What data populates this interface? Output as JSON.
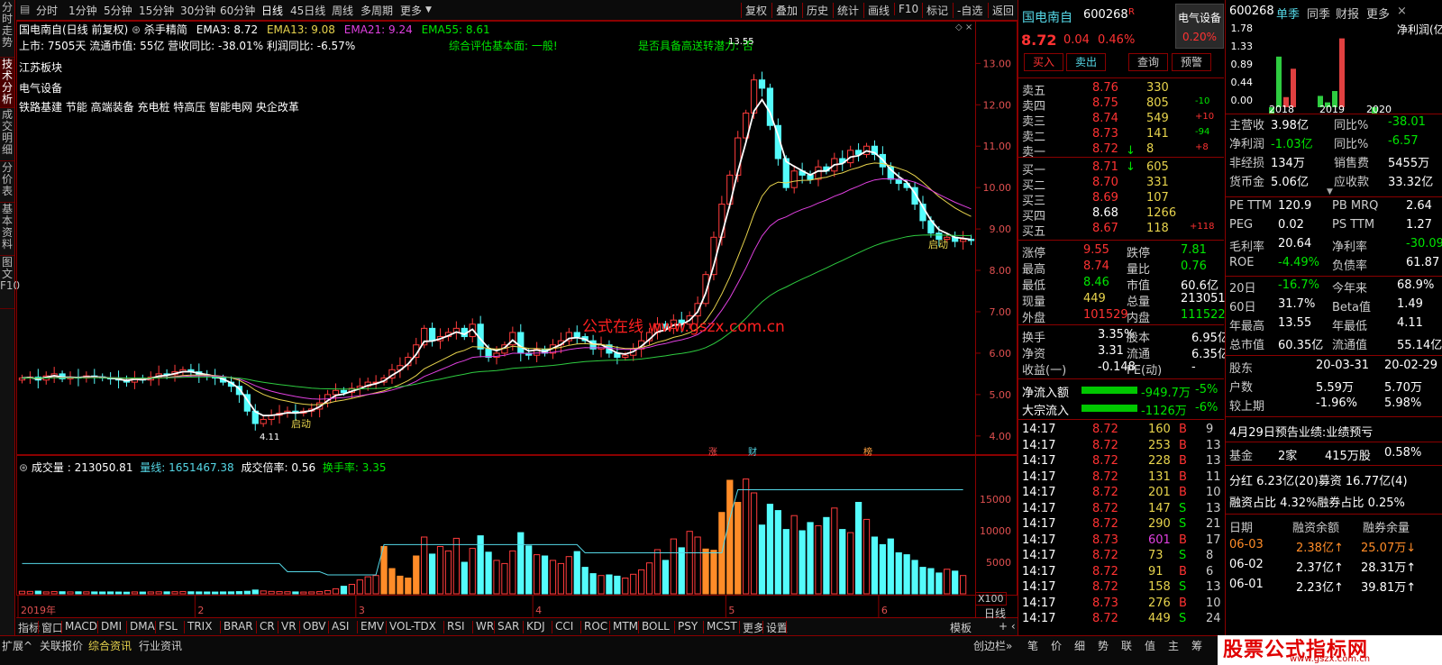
{
  "toolbar": {
    "items": [
      "分时",
      "1分钟",
      "5分钟",
      "15分钟",
      "30分钟",
      "60分钟",
      "日线",
      "45日线",
      "周线",
      "多周期",
      "更多"
    ],
    "right": [
      "复权",
      "叠加",
      "历史",
      "统计",
      "画线",
      "F10",
      "标记",
      "-自选",
      "返回"
    ]
  },
  "left_tabs": [
    "分时走势",
    "技术分析",
    "成交明细",
    "分价表",
    "基本资料",
    "图文F10"
  ],
  "chart_header": {
    "title": "国电南自(日线 前复权)",
    "formula": "杀手精简",
    "ema3": "EMA3: 8.72",
    "ema13": "EMA13: 9.08",
    "ema21": "EMA21: 9.24",
    "ema55": "EMA55: 8.61"
  },
  "info_lines": {
    "line1": "上市: 7505天  流通市值: 55亿    营收同比: -38.01% 利润同比: -6.57%",
    "eval": "综合评估基本面: 一般!",
    "gaosong": "是否具备高送转潜力: 否",
    "board": "江苏板块",
    "industry": "电气设备",
    "concepts": "铁路基建 节能 高端装备 充电桩 特高压 智能电网 央企改革"
  },
  "watermark": "公式在线 www.gszx.com.cn",
  "annotations": {
    "start1": "启动",
    "start2": "启动",
    "low": "4.11",
    "high": "13.55",
    "zhang": "涨",
    "cai": "财",
    "bang": "榜"
  },
  "price_axis": [
    "13.00",
    "12.00",
    "11.00",
    "10.00",
    "9.00",
    "8.00",
    "7.00",
    "6.00",
    "5.00",
    "4.00"
  ],
  "vol_axis": [
    "15000",
    "10000",
    "5000"
  ],
  "vol_unit": "X100",
  "vol_header": {
    "label": "成交量 : 213050.81",
    "liang": "量线: 1651467.38",
    "bei": "成交倍率: 0.56",
    "huan": "换手率: 3.35"
  },
  "x_labels": [
    "2019年",
    "2",
    "3",
    "4",
    "5",
    "6"
  ],
  "chart_data": {
    "type": "candlestick",
    "price_ylim": [
      3.8,
      13.9
    ],
    "vol_ylim": [
      0,
      20000
    ],
    "closes": [
      5.4,
      5.42,
      5.35,
      5.45,
      5.5,
      5.38,
      5.42,
      5.4,
      5.45,
      5.43,
      5.4,
      5.38,
      5.35,
      5.3,
      5.4,
      5.35,
      5.42,
      5.5,
      5.48,
      5.55,
      5.6,
      5.55,
      5.48,
      5.45,
      5.4,
      5.3,
      5.2,
      5.0,
      4.6,
      4.3,
      4.4,
      4.5,
      4.55,
      4.6,
      4.55,
      4.6,
      4.65,
      4.8,
      5.0,
      5.1,
      5.05,
      5.15,
      5.2,
      5.3,
      5.3,
      5.4,
      5.6,
      5.7,
      5.9,
      6.2,
      6.6,
      6.3,
      6.4,
      6.5,
      6.6,
      6.4,
      6.7,
      6.1,
      5.9,
      6.0,
      6.2,
      6.5,
      6.0,
      5.95,
      6.1,
      6.0,
      6.2,
      6.3,
      6.5,
      6.4,
      6.3,
      6.1,
      6.2,
      6.0,
      5.9,
      5.95,
      6.1,
      6.3,
      6.5,
      6.7,
      6.6,
      6.8,
      6.7,
      6.9,
      7.2,
      7.9,
      8.8,
      9.6,
      10.3,
      11.2,
      11.8,
      12.6,
      12.4,
      11.5,
      10.7,
      10.0,
      10.4,
      10.3,
      10.2,
      10.5,
      10.4,
      10.7,
      10.6,
      10.9,
      10.8,
      11.0,
      10.8,
      10.5,
      10.2,
      10.1,
      10.0,
      9.6,
      9.2,
      8.9,
      8.75,
      8.8,
      8.7,
      8.75,
      8.72
    ],
    "volumes": [
      400,
      380,
      420,
      300,
      350,
      330,
      300,
      320,
      310,
      300,
      290,
      300,
      280,
      260,
      300,
      280,
      300,
      320,
      310,
      330,
      350,
      320,
      300,
      290,
      280,
      300,
      310,
      350,
      400,
      600,
      450,
      380,
      350,
      330,
      300,
      280,
      300,
      350,
      500,
      800,
      1200,
      1500,
      2200,
      2700,
      2900,
      7500,
      4000,
      2800,
      2500,
      6000,
      9000,
      6300,
      7500,
      6800,
      8800,
      5000,
      7200,
      9200,
      6600,
      5300,
      4800,
      6800,
      9700,
      7600,
      6200,
      6000,
      5300,
      4800,
      5900,
      6700,
      4200,
      3200,
      2900,
      3000,
      2800,
      2500,
      3100,
      3800,
      4900,
      7000,
      5300,
      8700,
      7300,
      9900,
      9000,
      7100,
      6900,
      12900,
      18000,
      14500,
      18200,
      16000,
      10900,
      14200,
      13200,
      10200,
      12400,
      10000,
      11300,
      10800,
      12100,
      13600,
      10200,
      9700,
      14500,
      11800,
      9000,
      7800,
      8700,
      6500,
      6200,
      5300,
      4200,
      4000,
      3300,
      3900,
      3600,
      2900
    ]
  },
  "quote": {
    "name": "国电南自",
    "code": "600268",
    "r": "R",
    "ind_tag": "电气设备",
    "price": "8.72",
    "chg": "0.04",
    "pct": "0.46%",
    "ind_pct": "0.20%",
    "buy": "买入",
    "sell": "卖出",
    "query": "查询",
    "warn": "预警"
  },
  "asks": [
    {
      "l": "卖五",
      "p": "8.76",
      "v": "330",
      "d": ""
    },
    {
      "l": "卖四",
      "p": "8.75",
      "v": "805",
      "d": "-10"
    },
    {
      "l": "卖三",
      "p": "8.74",
      "v": "549",
      "d": "+10"
    },
    {
      "l": "卖二",
      "p": "8.73",
      "v": "141",
      "d": "-94"
    },
    {
      "l": "卖一",
      "p": "8.72",
      "v": "8",
      "d": "+8"
    }
  ],
  "bids": [
    {
      "l": "买一",
      "p": "8.71",
      "v": "605",
      "d": ""
    },
    {
      "l": "买二",
      "p": "8.70",
      "v": "331",
      "d": ""
    },
    {
      "l": "买三",
      "p": "8.69",
      "v": "107",
      "d": ""
    },
    {
      "l": "买四",
      "p": "8.68",
      "v": "1266",
      "d": ""
    },
    {
      "l": "买五",
      "p": "8.67",
      "v": "118",
      "d": "+118"
    }
  ],
  "stats": [
    {
      "a": "涨停",
      "av": "9.55",
      "b": "跌停",
      "bv": "7.81"
    },
    {
      "a": "最高",
      "av": "8.74",
      "b": "量比",
      "bv": "0.76"
    },
    {
      "a": "最低",
      "av": "8.46",
      "b": "市值",
      "bv": "60.6亿"
    },
    {
      "a": "现量",
      "av": "449",
      "b": "总量",
      "bv": "213051"
    },
    {
      "a": "外盘",
      "av": "101529",
      "b": "内盘",
      "bv": "111522"
    }
  ],
  "stats2": [
    {
      "a": "换手",
      "av": "3.35%",
      "b": "股本",
      "bv": "6.95亿"
    },
    {
      "a": "净资",
      "av": "3.31",
      "b": "流通",
      "bv": "6.35亿"
    },
    {
      "a": "收益(一)",
      "av": "-0.148",
      "b": "PE(动)",
      "bv": "-"
    }
  ],
  "flow": [
    {
      "l": "净流入额",
      "v": "-949.7万",
      "p": "-5%"
    },
    {
      "l": "大宗流入",
      "v": "-1126万",
      "p": "-6%"
    }
  ],
  "ticks": [
    [
      "14:17",
      "8.72",
      "160",
      "B",
      "9"
    ],
    [
      "14:17",
      "8.72",
      "253",
      "B",
      "13"
    ],
    [
      "14:17",
      "8.72",
      "228",
      "B",
      "13"
    ],
    [
      "14:17",
      "8.72",
      "131",
      "B",
      "11"
    ],
    [
      "14:17",
      "8.72",
      "201",
      "B",
      "10"
    ],
    [
      "14:17",
      "8.72",
      "147",
      "S",
      "13"
    ],
    [
      "14:17",
      "8.72",
      "290",
      "S",
      "21"
    ],
    [
      "14:17",
      "8.73",
      "601",
      "B",
      "17"
    ],
    [
      "14:17",
      "8.72",
      "73",
      "S",
      "8"
    ],
    [
      "14:17",
      "8.72",
      "91",
      "B",
      "6"
    ],
    [
      "14:17",
      "8.72",
      "158",
      "S",
      "13"
    ],
    [
      "14:17",
      "8.73",
      "276",
      "B",
      "10"
    ],
    [
      "14:17",
      "8.72",
      "449",
      "S",
      "24"
    ]
  ],
  "f10": {
    "code": "600268",
    "tabs": [
      "单季",
      "同季",
      "财报",
      "更多"
    ],
    "bar_title": "净利润(亿)",
    "bar_axis": [
      "1.78",
      "1.33",
      "0.89",
      "0.44",
      "0.00"
    ],
    "years": [
      "2018",
      "2019",
      "2020"
    ],
    "rows": [
      {
        "a": "主营收",
        "av": "3.98亿",
        "b": "同比%",
        "bv": "-38.01"
      },
      {
        "a": "净利润",
        "av": "-1.03亿",
        "b": "同比%",
        "bv": "-6.57"
      },
      {
        "a": "非经损",
        "av": "134万",
        "b": "销售费",
        "bv": "5455万"
      },
      {
        "a": "货币金",
        "av": "5.06亿",
        "b": "应收款",
        "bv": "33.32亿"
      }
    ],
    "rows2": [
      {
        "a": "PE TTM",
        "av": "120.9",
        "b": "PB MRQ",
        "bv": "2.64"
      },
      {
        "a": "PEG",
        "av": "0.02",
        "b": "PS TTM",
        "bv": "1.27"
      },
      {
        "a": "毛利率",
        "av": "20.64",
        "b": "净利率",
        "bv": "-30.09"
      },
      {
        "a": "ROE",
        "av": "-4.49%",
        "b": "负债率",
        "bv": "61.87"
      }
    ],
    "rows3": [
      {
        "a": "20日",
        "av": "-16.7%",
        "b": "今年来",
        "bv": "68.9%"
      },
      {
        "a": "60日",
        "av": "31.7%",
        "b": "Beta值",
        "bv": "1.49"
      },
      {
        "a": "年最高",
        "av": "13.55",
        "b": "年最低",
        "bv": "4.11"
      },
      {
        "a": "总市值",
        "av": "60.35亿",
        "b": "流通值",
        "bv": "55.14亿"
      }
    ],
    "holders": [
      {
        "a": "股东",
        "av": "20-03-31",
        "bv": "20-02-29"
      },
      {
        "a": "户数",
        "av": "5.59万",
        "bv": "5.70万"
      },
      {
        "a": "较上期",
        "av": "-1.96%",
        "bv": "5.98%"
      }
    ],
    "notice": "4月29日预告业绩:业绩预亏",
    "fund": {
      "a": "基金",
      "av": "2家",
      "bv": "415万股",
      "cv": "0.58%"
    },
    "fenhong": "分红 6.23亿(20)募资 16.77亿(4)",
    "rzzb": "融资占比 4.32%融券占比 0.25%",
    "margin_hdr": [
      "日期",
      "融资余额",
      "融券余量"
    ],
    "margin": [
      [
        "06-03",
        "2.38亿↑",
        "25.07万↓"
      ],
      [
        "06-02",
        "2.37亿↑",
        "28.31万↑"
      ],
      [
        "06-01",
        "2.23亿↑",
        "39.81万↑"
      ]
    ]
  },
  "indicators": [
    "指标",
    "窗口",
    "MACD",
    "DMI",
    "DMA",
    "FSL",
    "TRIX",
    "BRAR",
    "CR",
    "VR",
    "OBV",
    "ASI",
    "EMV",
    "VOL-TDX",
    "RSI",
    "WR",
    "SAR",
    "KDJ",
    "CCI",
    "ROC",
    "MTM",
    "BOLL",
    "PSY",
    "MCST",
    "更多",
    "设置"
  ],
  "ind_right": [
    "模板",
    "日线"
  ],
  "status": [
    "扩展^",
    "关联报价",
    "综合资讯",
    "行业资讯",
    "创边栏»",
    "笔",
    "价",
    "细",
    "势",
    "联",
    "值",
    "主",
    "筹"
  ],
  "wm_text": "股票公式指标网",
  "wm_url": "www.gszx.com.cn"
}
